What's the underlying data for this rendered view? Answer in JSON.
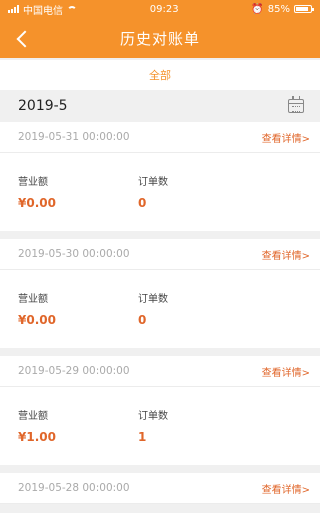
{
  "status": {
    "carrier": "中国电信",
    "time": "09:23",
    "battery": "85%"
  },
  "header": {
    "title": "历史对账单"
  },
  "filter": {
    "label": "全部"
  },
  "month": {
    "label": "2019-5"
  },
  "records": [
    {
      "date": "2019-05-31 00:00:00",
      "link": "查看详情>",
      "revenue_label": "营业额",
      "revenue": "¥0.00",
      "orders_label": "订单数",
      "orders": "0"
    },
    {
      "date": "2019-05-30 00:00:00",
      "link": "查看详情>",
      "revenue_label": "营业额",
      "revenue": "¥0.00",
      "orders_label": "订单数",
      "orders": "0"
    },
    {
      "date": "2019-05-29 00:00:00",
      "link": "查看详情>",
      "revenue_label": "营业额",
      "revenue": "¥1.00",
      "orders_label": "订单数",
      "orders": "1"
    },
    {
      "date": "2019-05-28 00:00:00",
      "link": "查看详情>"
    }
  ],
  "colors": {
    "accent": "#f5922b",
    "value": "#e0662a"
  }
}
